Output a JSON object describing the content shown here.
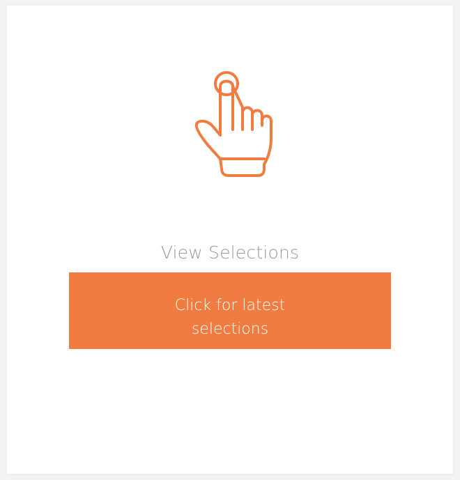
{
  "card": {
    "icon": "tap-hand-icon",
    "title": "View Selections",
    "button_label": "Click for latest selections"
  },
  "colors": {
    "accent": "#f07c41",
    "title_text": "#9a9a9a",
    "button_text": "#ffffff",
    "card_bg": "#ffffff"
  }
}
